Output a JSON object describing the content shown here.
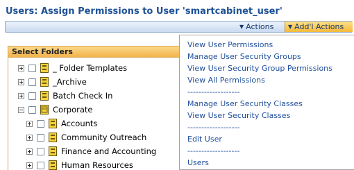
{
  "page": {
    "title": "Users: Assign Permissions to User 'smartcabinet_user'"
  },
  "action_bar": {
    "actions_label": "Actions",
    "addl_actions_label": "Add'l Actions"
  },
  "folders": {
    "header": "Select Folders",
    "items": [
      {
        "label": "_ Folder Templates",
        "expander": "plus"
      },
      {
        "label": "_Archive",
        "expander": "plus"
      },
      {
        "label": "Batch Check In",
        "expander": "plus"
      },
      {
        "label": "Corporate",
        "expander": "minus"
      },
      {
        "label": "Accounts",
        "expander": "plus"
      },
      {
        "label": "Community Outreach",
        "expander": "plus"
      },
      {
        "label": "Finance and Accounting",
        "expander": "plus"
      },
      {
        "label": "Human Resources",
        "expander": "plus"
      }
    ]
  },
  "addl_actions_menu": {
    "items": [
      "View User Permissions",
      "Manage User Security Groups",
      "View User Security Group Permissions",
      "View All Permissions",
      "-------------------",
      "Manage User Security Classes",
      "View User Security Classes",
      "-------------------",
      "Edit User",
      "-------------------",
      "Users"
    ]
  },
  "colors": {
    "title": "#1f5296",
    "link": "#1f4f9c",
    "header_gold": "#f2b24b",
    "bar_blue": "#c9daf1"
  }
}
